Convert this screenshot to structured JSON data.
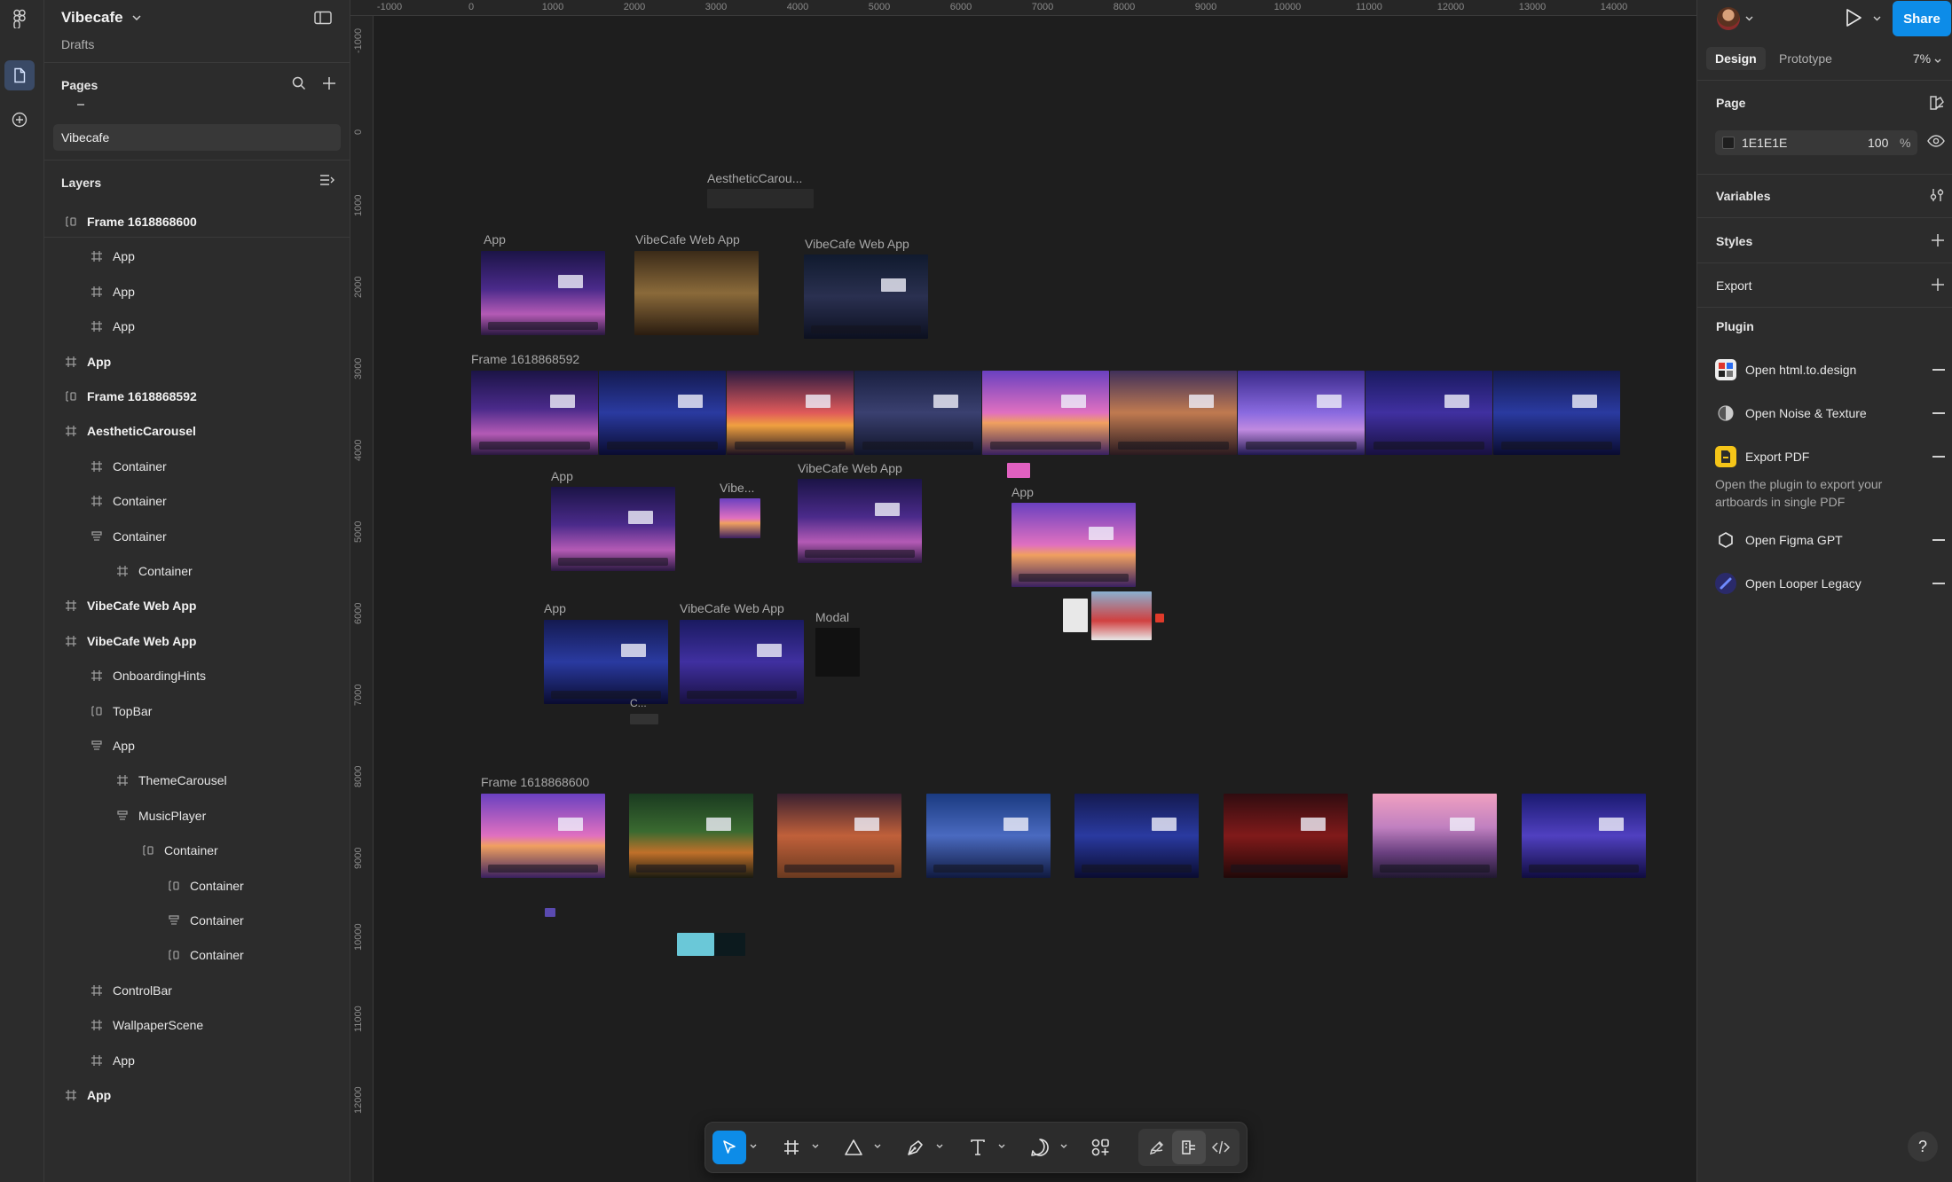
{
  "file": {
    "name": "Vibecafe",
    "location": "Drafts"
  },
  "pages": {
    "title": "Pages",
    "items": [
      {
        "label": "Vibecafe",
        "selected": true
      }
    ]
  },
  "layers": {
    "title": "Layers",
    "items": [
      {
        "label": "Frame 1618868600",
        "icon": "autolayout-icon",
        "indent": 0,
        "bold": true
      },
      {
        "label": "App",
        "icon": "frame-icon",
        "indent": 1,
        "bold": false
      },
      {
        "label": "App",
        "icon": "frame-icon",
        "indent": 1,
        "bold": false
      },
      {
        "label": "App",
        "icon": "frame-icon",
        "indent": 1,
        "bold": false
      },
      {
        "label": "App",
        "icon": "frame-icon",
        "indent": 0,
        "bold": true
      },
      {
        "label": "Frame 1618868592",
        "icon": "autolayout-icon",
        "indent": 0,
        "bold": true
      },
      {
        "label": "AestheticCarousel",
        "icon": "frame-icon",
        "indent": 0,
        "bold": true
      },
      {
        "label": "Container",
        "icon": "frame-icon",
        "indent": 1,
        "bold": false
      },
      {
        "label": "Container",
        "icon": "frame-icon",
        "indent": 1,
        "bold": false
      },
      {
        "label": "Container",
        "icon": "vstack-icon",
        "indent": 1,
        "bold": false
      },
      {
        "label": "Container",
        "icon": "frame-icon",
        "indent": 2,
        "bold": false
      },
      {
        "label": "VibeCafe Web App",
        "icon": "frame-icon",
        "indent": 0,
        "bold": true
      },
      {
        "label": "VibeCafe Web App",
        "icon": "frame-icon",
        "indent": 0,
        "bold": true
      },
      {
        "label": "OnboardingHints",
        "icon": "frame-icon",
        "indent": 1,
        "bold": false
      },
      {
        "label": "TopBar",
        "icon": "autolayout-icon",
        "indent": 1,
        "bold": false
      },
      {
        "label": "App",
        "icon": "vstack-icon",
        "indent": 1,
        "bold": false
      },
      {
        "label": "ThemeCarousel",
        "icon": "frame-icon",
        "indent": 2,
        "bold": false
      },
      {
        "label": "MusicPlayer",
        "icon": "vstack-icon",
        "indent": 2,
        "bold": false
      },
      {
        "label": "Container",
        "icon": "autolayout-icon",
        "indent": 3,
        "bold": false
      },
      {
        "label": "Container",
        "icon": "autolayout-icon",
        "indent": 4,
        "bold": false
      },
      {
        "label": "Container",
        "icon": "vstack-icon",
        "indent": 4,
        "bold": false
      },
      {
        "label": "Container",
        "icon": "autolayout-icon",
        "indent": 4,
        "bold": false
      },
      {
        "label": "ControlBar",
        "icon": "frame-icon",
        "indent": 1,
        "bold": false
      },
      {
        "label": "WallpaperScene",
        "icon": "frame-icon",
        "indent": 1,
        "bold": false
      },
      {
        "label": "App",
        "icon": "frame-icon",
        "indent": 1,
        "bold": false
      },
      {
        "label": "App",
        "icon": "frame-icon",
        "indent": 0,
        "bold": true
      }
    ]
  },
  "rulers": {
    "top": [
      "-1000",
      "0",
      "1000",
      "2000",
      "3000",
      "4000",
      "5000",
      "6000",
      "7000",
      "8000",
      "9000",
      "10000",
      "11000",
      "12000",
      "13000",
      "14000"
    ],
    "left": [
      "-1000",
      "0",
      "1000",
      "2000",
      "3000",
      "4000",
      "5000",
      "6000",
      "7000",
      "8000",
      "9000",
      "10000",
      "11000",
      "12000"
    ]
  },
  "canvas": {
    "labels": {
      "aesthetic": "AestheticCarou...",
      "app1": "App",
      "web1": "VibeCafe Web App",
      "web2": "VibeCafe Web App",
      "frame592": "Frame 1618868592",
      "app2": "App",
      "vibe": "Vibe...",
      "web3": "VibeCafe Web App",
      "app3": "App",
      "app4": "App",
      "web4": "VibeCafe Web App",
      "modal": "Modal",
      "c": "C...",
      "frame600": "Frame 1618868600"
    }
  },
  "design_panel": {
    "tabs": [
      "Design",
      "Prototype"
    ],
    "active_tab": "Design",
    "zoom": "7%",
    "share_label": "Share",
    "page_section": "Page",
    "page_color": "1E1E1E",
    "page_opacity": "100",
    "percent": "%",
    "variables": "Variables",
    "styles": "Styles",
    "export": "Export",
    "plugin": "Plugin",
    "plugins": [
      {
        "label": "Open html.to.design"
      },
      {
        "label": "Open Noise & Texture"
      },
      {
        "label": "Export PDF"
      },
      {
        "label": "Open Figma GPT"
      },
      {
        "label": "Open Looper Legacy"
      }
    ],
    "plugin_desc": "Open the plugin to export your artboards in single PDF",
    "help": "?"
  },
  "colors": {
    "accent": "#0d8ce8",
    "canvas_bg": "#1e1e1e",
    "panel_bg": "#2c2c2c"
  }
}
